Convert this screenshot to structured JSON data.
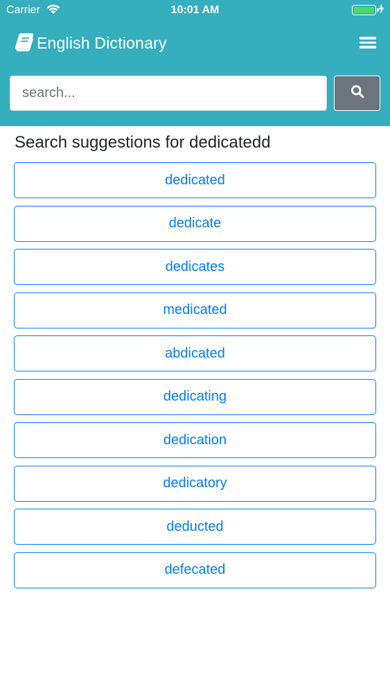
{
  "status_bar": {
    "carrier": "Carrier",
    "time": "10:01 AM",
    "battery_level": 1.0
  },
  "header": {
    "title": "English Dictionary",
    "icon": "book-icon",
    "menu_icon": "hamburger-menu-icon",
    "background_color": "#35aebe"
  },
  "search": {
    "placeholder": "search...",
    "value": "",
    "button_icon": "search-icon"
  },
  "results": {
    "heading": "Search suggestions for dedicatedd",
    "accent_color": "#007bff",
    "suggestions": [
      "dedicated",
      "dedicate",
      "dedicates",
      "medicated",
      "abdicated",
      "dedicating",
      "dedication",
      "dedicatory",
      "deducted",
      "defecated"
    ]
  }
}
